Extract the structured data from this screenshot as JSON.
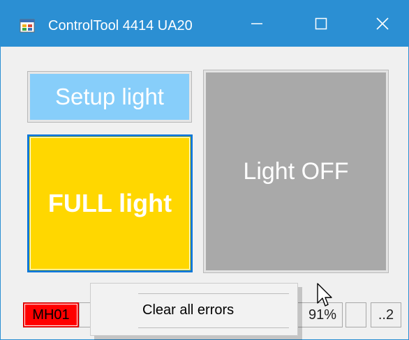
{
  "window": {
    "title": "ControlTool 4414 UA20",
    "icon": "app-window-icon",
    "controls": [
      "minimize-icon",
      "maximize-icon",
      "close-icon"
    ]
  },
  "buttons": {
    "setup_light": "Setup light",
    "full_light": "FULL light",
    "light_off": "Light OFF"
  },
  "status_bar": {
    "mh_label": "MH01",
    "blank1": "",
    "percent": "91%",
    "blank2": "",
    "page": "..2"
  },
  "context_menu": {
    "items": [
      "Clear all errors"
    ]
  },
  "colors": {
    "titlebar": "#2b8fd3",
    "setup_bg": "#87cefa",
    "full_bg": "#ffd700",
    "off_bg": "#a9a9a9",
    "mh_bg": "#ff0000",
    "focus_border": "#0a78d7"
  }
}
